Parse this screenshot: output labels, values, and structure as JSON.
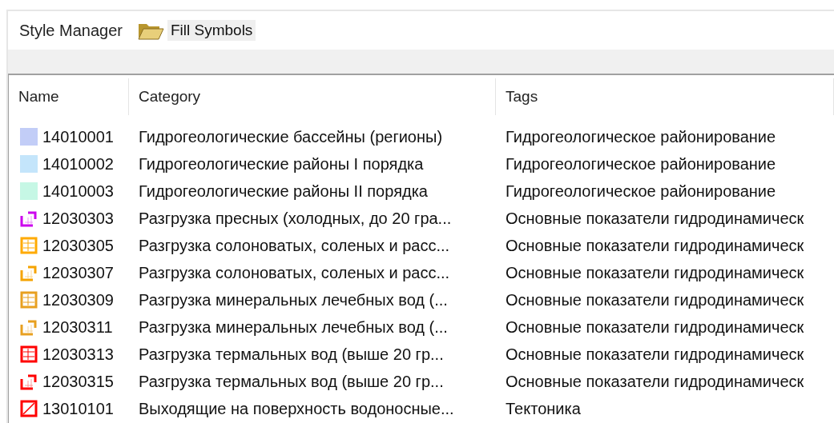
{
  "header": {
    "title": "Style Manager",
    "folder": "Fill Symbols"
  },
  "table": {
    "columns": [
      "Name",
      "Category",
      "Tags"
    ],
    "rows": [
      {
        "symbol": {
          "kind": "solid",
          "color": "#c2cdf7"
        },
        "name": "14010001",
        "category": "Гидрогеологические бассейны (регионы)",
        "tags": "Гидрогеологическое районирование"
      },
      {
        "symbol": {
          "kind": "solid",
          "color": "#c4e5fb"
        },
        "name": "14010002",
        "category": "Гидрогеологические районы I порядка",
        "tags": "Гидрогеологическое районирование"
      },
      {
        "symbol": {
          "kind": "solid",
          "color": "#c6f7e5"
        },
        "name": "14010003",
        "category": "Гидрогеологические районы II порядка",
        "tags": "Гидрогеологическое районирование"
      },
      {
        "symbol": {
          "kind": "corner",
          "color": "#cc00ee"
        },
        "name": "12030303",
        "category": "Разгрузка пресных (холодных, до 20 гра...",
        "tags": "Основные показатели гидродинамическ"
      },
      {
        "symbol": {
          "kind": "framed",
          "color": "#ffaa00"
        },
        "name": "12030305",
        "category": "Разгрузка солоноватых, соленых и расс...",
        "tags": "Основные показатели гидродинамическ"
      },
      {
        "symbol": {
          "kind": "corner",
          "color": "#f5a300"
        },
        "name": "12030307",
        "category": "Разгрузка солоноватых, соленых и расс...",
        "tags": "Основные показатели гидродинамическ"
      },
      {
        "symbol": {
          "kind": "framed",
          "color": "#e8a020"
        },
        "name": "12030309",
        "category": "Разгрузка минеральных лечебных вод (...",
        "tags": "Основные показатели гидродинамическ"
      },
      {
        "symbol": {
          "kind": "corner",
          "color": "#e8a020"
        },
        "name": "12030311",
        "category": "Разгрузка минеральных лечебных вод (...",
        "tags": "Основные показатели гидродинамическ"
      },
      {
        "symbol": {
          "kind": "framed",
          "color": "#ff0000"
        },
        "name": "12030313",
        "category": "Разгрузка термальных вод (выше 20 гр...",
        "tags": "Основные показатели гидродинамическ"
      },
      {
        "symbol": {
          "kind": "corner",
          "color": "#ff0000"
        },
        "name": "12030315",
        "category": "Разгрузка термальных вод (выше 20 гр...",
        "tags": "Основные показатели гидродинамическ"
      },
      {
        "symbol": {
          "kind": "diagonal",
          "color": "#ff0000"
        },
        "name": "13010101",
        "category": "Выходящие на поверхность водоносные...",
        "tags": "Тектоника"
      }
    ]
  }
}
